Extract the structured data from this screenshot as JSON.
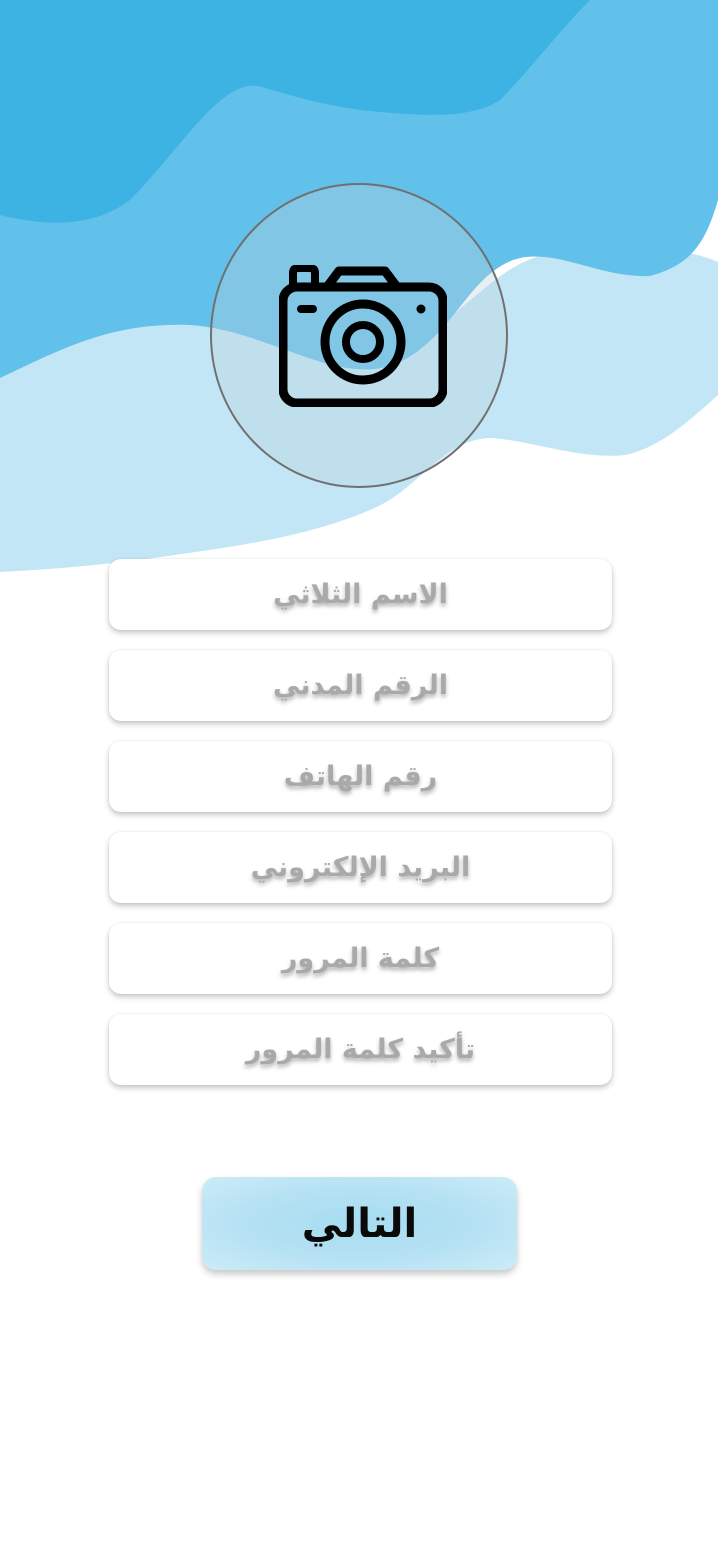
{
  "theme": {
    "wave_dark": "#3cb3e3",
    "wave_mid": "#62c1ea",
    "wave_light": "#c2e6f6",
    "field_text_color": "#a9a9a9",
    "button_color": "#b3e0f3"
  },
  "avatar": {
    "icon": "camera-icon"
  },
  "form": {
    "fields": [
      {
        "label": "الاسم الثلاثي"
      },
      {
        "label": "الرقم المدني"
      },
      {
        "label": "رقم الهاتف"
      },
      {
        "label": "البريد الإلكتروني"
      },
      {
        "label": "كلمة المرور"
      },
      {
        "label": "تأكيد كلمة المرور"
      }
    ]
  },
  "next_button": {
    "label": "التالي"
  }
}
